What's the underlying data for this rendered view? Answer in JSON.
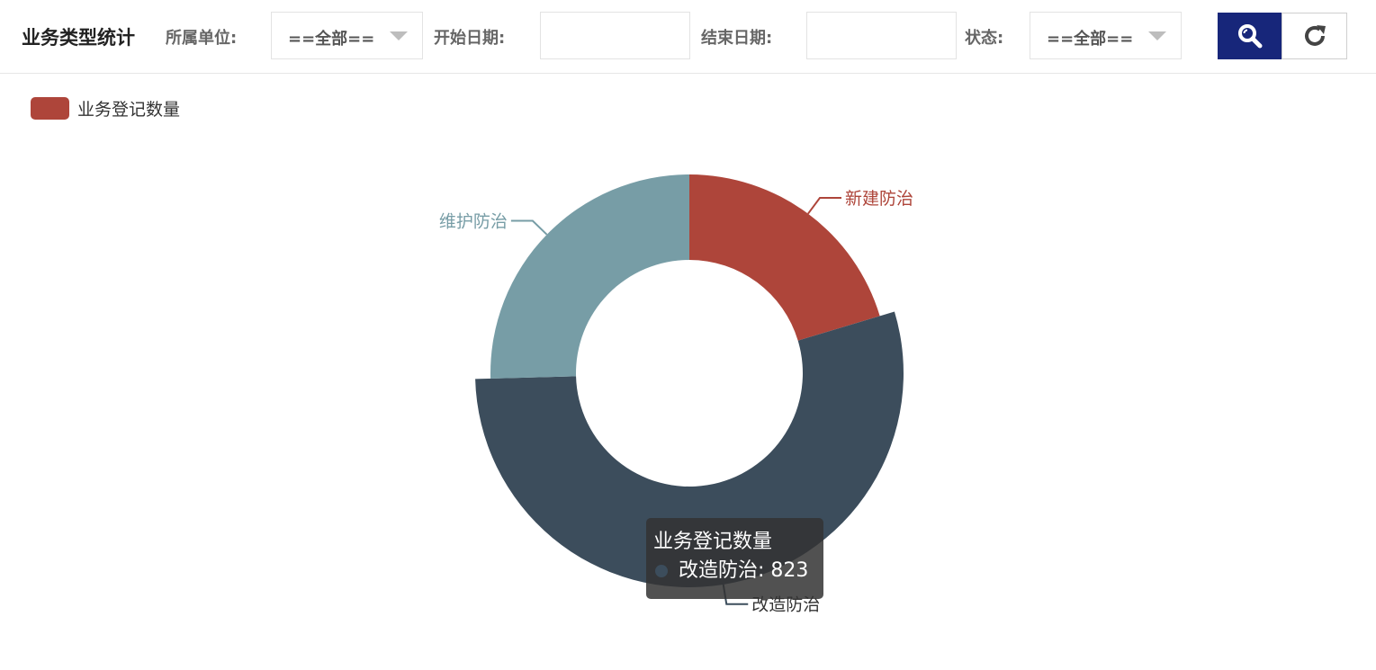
{
  "toolbar": {
    "title": "业务类型统计",
    "unit_label": "所属单位:",
    "unit_value": "==全部==",
    "start_label": "开始日期:",
    "start_value": "",
    "end_label": "结束日期:",
    "end_value": "",
    "status_label": "状态:",
    "status_value": "==全部=="
  },
  "icons": {
    "search": "search-icon",
    "refresh": "refresh-icon",
    "dropdown": "chevron-down-icon"
  },
  "colors": {
    "search_button": "#17267a"
  },
  "chart_data": {
    "type": "pie",
    "donut": true,
    "legend": [
      "业务登记数量"
    ],
    "legend_position": "top-left",
    "series": [
      {
        "name": "业务登记数量",
        "slices": [
          {
            "label": "新建防治",
            "value": 309,
            "color": "#ae453a"
          },
          {
            "label": "改造防治",
            "value": 823,
            "color": "#3c4d5c"
          },
          {
            "label": "维护防治",
            "value": 386,
            "color": "#779da6"
          }
        ]
      }
    ],
    "highlighted": "改造防治",
    "tooltip": {
      "title": "业务登记数量",
      "label": "改造防治",
      "value": 823
    }
  }
}
